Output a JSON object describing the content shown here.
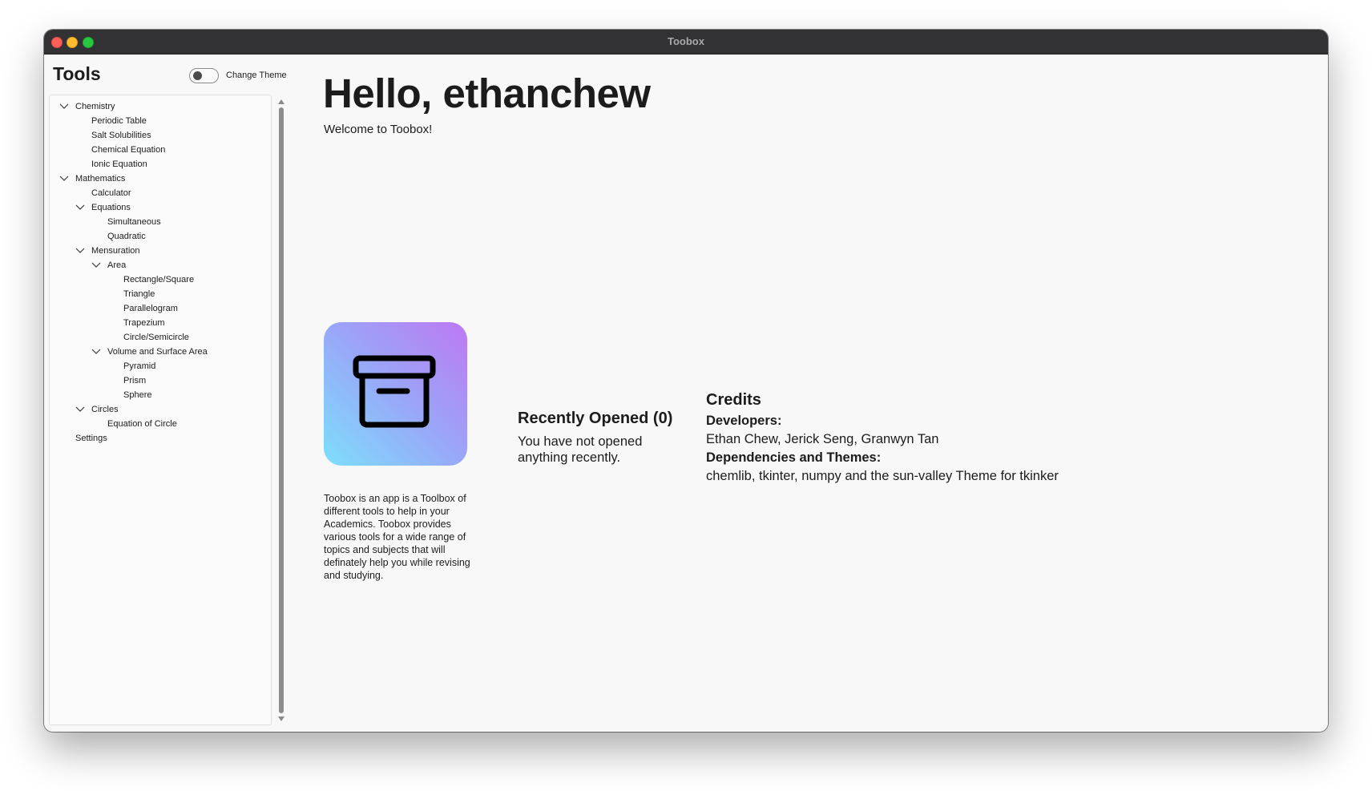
{
  "window": {
    "title": "Toobox"
  },
  "sidebar": {
    "title": "Tools",
    "theme_toggle": {
      "label": "Change Theme",
      "on": false
    },
    "tree": [
      {
        "label": "Chemistry",
        "level": 0,
        "expandable": true,
        "expanded": true
      },
      {
        "label": "Periodic Table",
        "level": 1,
        "expandable": false
      },
      {
        "label": "Salt Solubilities",
        "level": 1,
        "expandable": false
      },
      {
        "label": "Chemical Equation",
        "level": 1,
        "expandable": false
      },
      {
        "label": "Ionic Equation",
        "level": 1,
        "expandable": false
      },
      {
        "label": "Mathematics",
        "level": 0,
        "expandable": true,
        "expanded": true
      },
      {
        "label": "Calculator",
        "level": 1,
        "expandable": false
      },
      {
        "label": "Equations",
        "level": 1,
        "expandable": true,
        "expanded": true
      },
      {
        "label": "Simultaneous",
        "level": 2,
        "expandable": false
      },
      {
        "label": "Quadratic",
        "level": 2,
        "expandable": false
      },
      {
        "label": "Mensuration",
        "level": 1,
        "expandable": true,
        "expanded": true
      },
      {
        "label": "Area",
        "level": 2,
        "expandable": true,
        "expanded": true
      },
      {
        "label": "Rectangle/Square",
        "level": 3,
        "expandable": false
      },
      {
        "label": "Triangle",
        "level": 3,
        "expandable": false
      },
      {
        "label": "Parallelogram",
        "level": 3,
        "expandable": false
      },
      {
        "label": "Trapezium",
        "level": 3,
        "expandable": false
      },
      {
        "label": "Circle/Semicircle",
        "level": 3,
        "expandable": false
      },
      {
        "label": "Volume and Surface Area",
        "level": 2,
        "expandable": true,
        "expanded": true
      },
      {
        "label": "Pyramid",
        "level": 3,
        "expandable": false
      },
      {
        "label": "Prism",
        "level": 3,
        "expandable": false
      },
      {
        "label": "Sphere",
        "level": 3,
        "expandable": false
      },
      {
        "label": "Circles",
        "level": 1,
        "expandable": true,
        "expanded": true
      },
      {
        "label": "Equation of Circle",
        "level": 2,
        "expandable": false
      },
      {
        "label": "Settings",
        "level": 0,
        "expandable": false
      }
    ]
  },
  "main": {
    "greeting": "Hello, ethanchew",
    "welcome": "Welcome to Toobox!",
    "icon": "archive-box-icon",
    "about": "Toobox is an app is a Toolbox of different tools to help in your Academics. Toobox provides various tools for a wide range of topics and subjects that will definately help you while revising and studying.",
    "recent": {
      "title": "Recently Opened (0)",
      "empty_text": "You have not opened anything recently."
    },
    "credits": {
      "title": "Credits",
      "developers_heading": "Developers:",
      "developers": "Ethan Chew, Jerick Seng, Granwyn Tan",
      "dependencies_heading": "Dependencies and Themes:",
      "dependencies": "chemlib, tkinter, numpy and the sun-valley Theme for tkinker"
    }
  },
  "colors": {
    "titlebar": "#323234",
    "background": "#f8f8f8",
    "icon_gradient_start": "#7ddffc",
    "icon_gradient_end": "#bd78f3",
    "text": "#1c1c1c"
  }
}
